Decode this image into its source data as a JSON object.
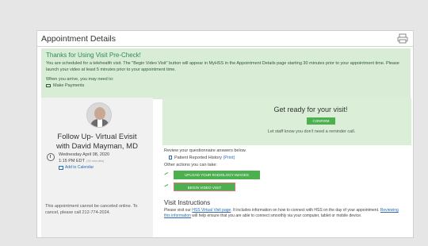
{
  "card": {
    "title": "Appointment Details",
    "print_icon": "printer-icon"
  },
  "notice": {
    "title": "Thanks for Using Visit Pre-Check!",
    "body": "You are scheduled for a telehealth visit. The \"Begin Video Visit\" button will appear in MyHSS in the Appointment Details page starting 30 minutes prior to your appointment time. Please launch your video at least 5 minutes prior to your appointment time.",
    "arrive_label": "When you arrive, you may need to:",
    "payment_label": "Make Payments"
  },
  "visit": {
    "title_line1": "Follow Up- Virtual Evisit",
    "title_line2": "with David Mayman, MD",
    "date": "Wednesday April 08, 2020",
    "time": "1:15 PM EDT",
    "duration": "(30 minutes)",
    "add_calendar": "Add to Calendar",
    "cancel_note": "This appointment cannot be canceled online. To cancel, please call 212-774-2024."
  },
  "ready": {
    "title": "Get ready for your visit!",
    "confirm": "CONFIRM",
    "note": "Let staff know you don't need a reminder call."
  },
  "actions": {
    "review_text": "Review your questionnaire answers below.",
    "prh_text": "Patient Reported History",
    "prh_print": "(Print)",
    "other_text": "Other actions you can take:",
    "upload_label": "UPLOAD YOUR RADIOLOGY IMAGES",
    "begin_label": "BEGIN VIDEO VISIT"
  },
  "instructions": {
    "title": "Visit Instructions",
    "p1": "Please visit our ",
    "link1": "HSS Virtual Visit page",
    "p2": ". It includes information on how to connect with HSS on the day of your appointment. ",
    "link2": "Reviewing this information",
    "p3": " will help ensure that you are able to connect smoothly via your computer, tablet or mobile device."
  },
  "colors": {
    "accent_green": "#4caf50",
    "link_blue": "#2b6cb0",
    "notice_bg": "#d8ecd6"
  }
}
